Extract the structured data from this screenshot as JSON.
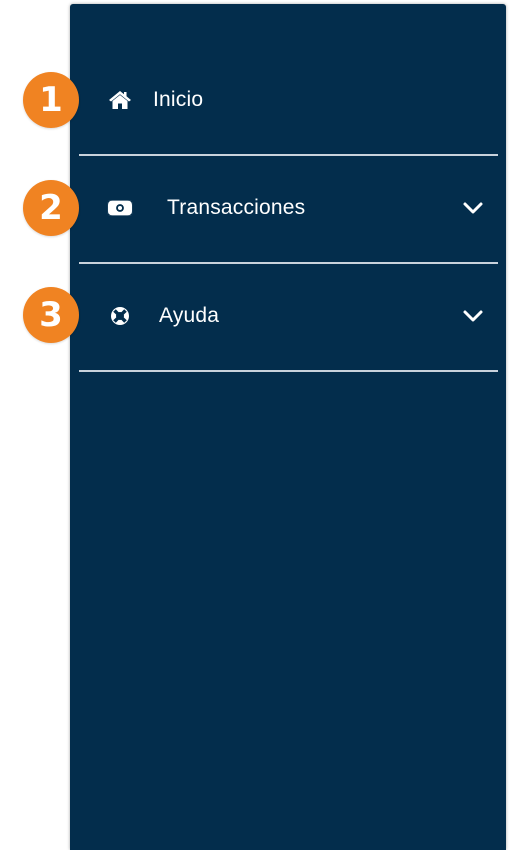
{
  "colors": {
    "sidebar_bg": "#032d4c",
    "divider": "#c9d2dc",
    "badge": "#f08322",
    "text": "#ffffff"
  },
  "menu": {
    "items": [
      {
        "label": "Inicio",
        "icon": "home-icon",
        "expandable": false
      },
      {
        "label": "Transacciones",
        "icon": "money-icon",
        "expandable": true
      },
      {
        "label": "Ayuda",
        "icon": "life-ring-icon",
        "expandable": true
      }
    ]
  },
  "badges": [
    "1",
    "2",
    "3"
  ]
}
